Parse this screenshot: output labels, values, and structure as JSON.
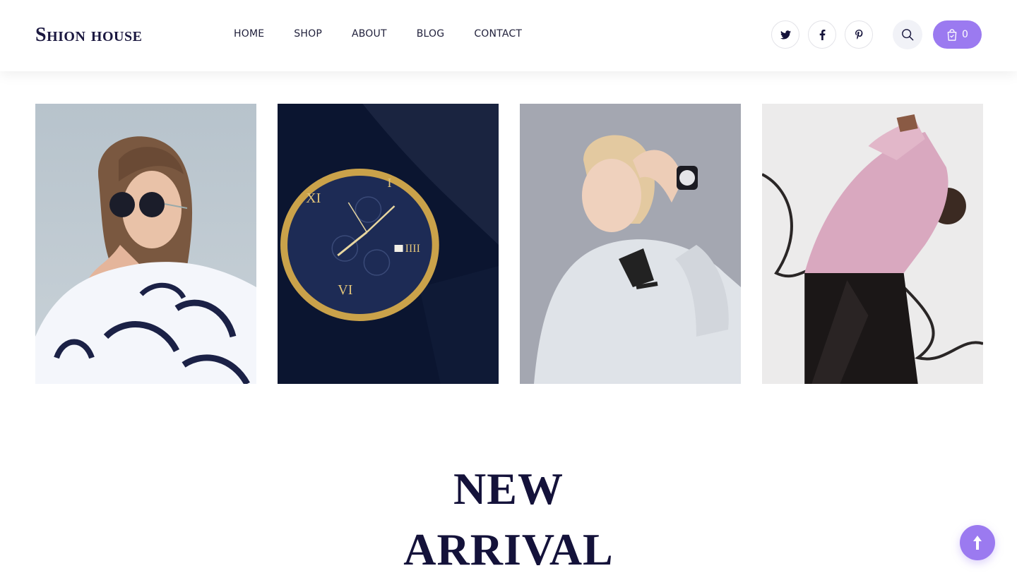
{
  "brand": {
    "logo_text": "Shion house"
  },
  "nav": {
    "items": [
      {
        "label": "HOME"
      },
      {
        "label": "SHOP"
      },
      {
        "label": "ABOUT"
      },
      {
        "label": "BLOG"
      },
      {
        "label": "CONTACT"
      }
    ]
  },
  "social": [
    "twitter-icon",
    "facebook-icon",
    "pinterest-icon"
  ],
  "search": {
    "icon": "search-icon"
  },
  "cart": {
    "icon": "shopping-bag-icon",
    "count": "0"
  },
  "gallery": {
    "images": [
      {
        "name": "woman-sunglasses-photo"
      },
      {
        "name": "wristwatch-photo"
      },
      {
        "name": "woman-hoodie-smartwatch-photo"
      },
      {
        "name": "woman-pink-jacket-photo"
      }
    ]
  },
  "section": {
    "title_line1": "NEW",
    "title_line2": "ARRIVAL"
  },
  "colors": {
    "accent": "#9b7af0",
    "heading": "#14123a"
  },
  "scroll_top": {
    "icon": "arrow-up-icon"
  }
}
